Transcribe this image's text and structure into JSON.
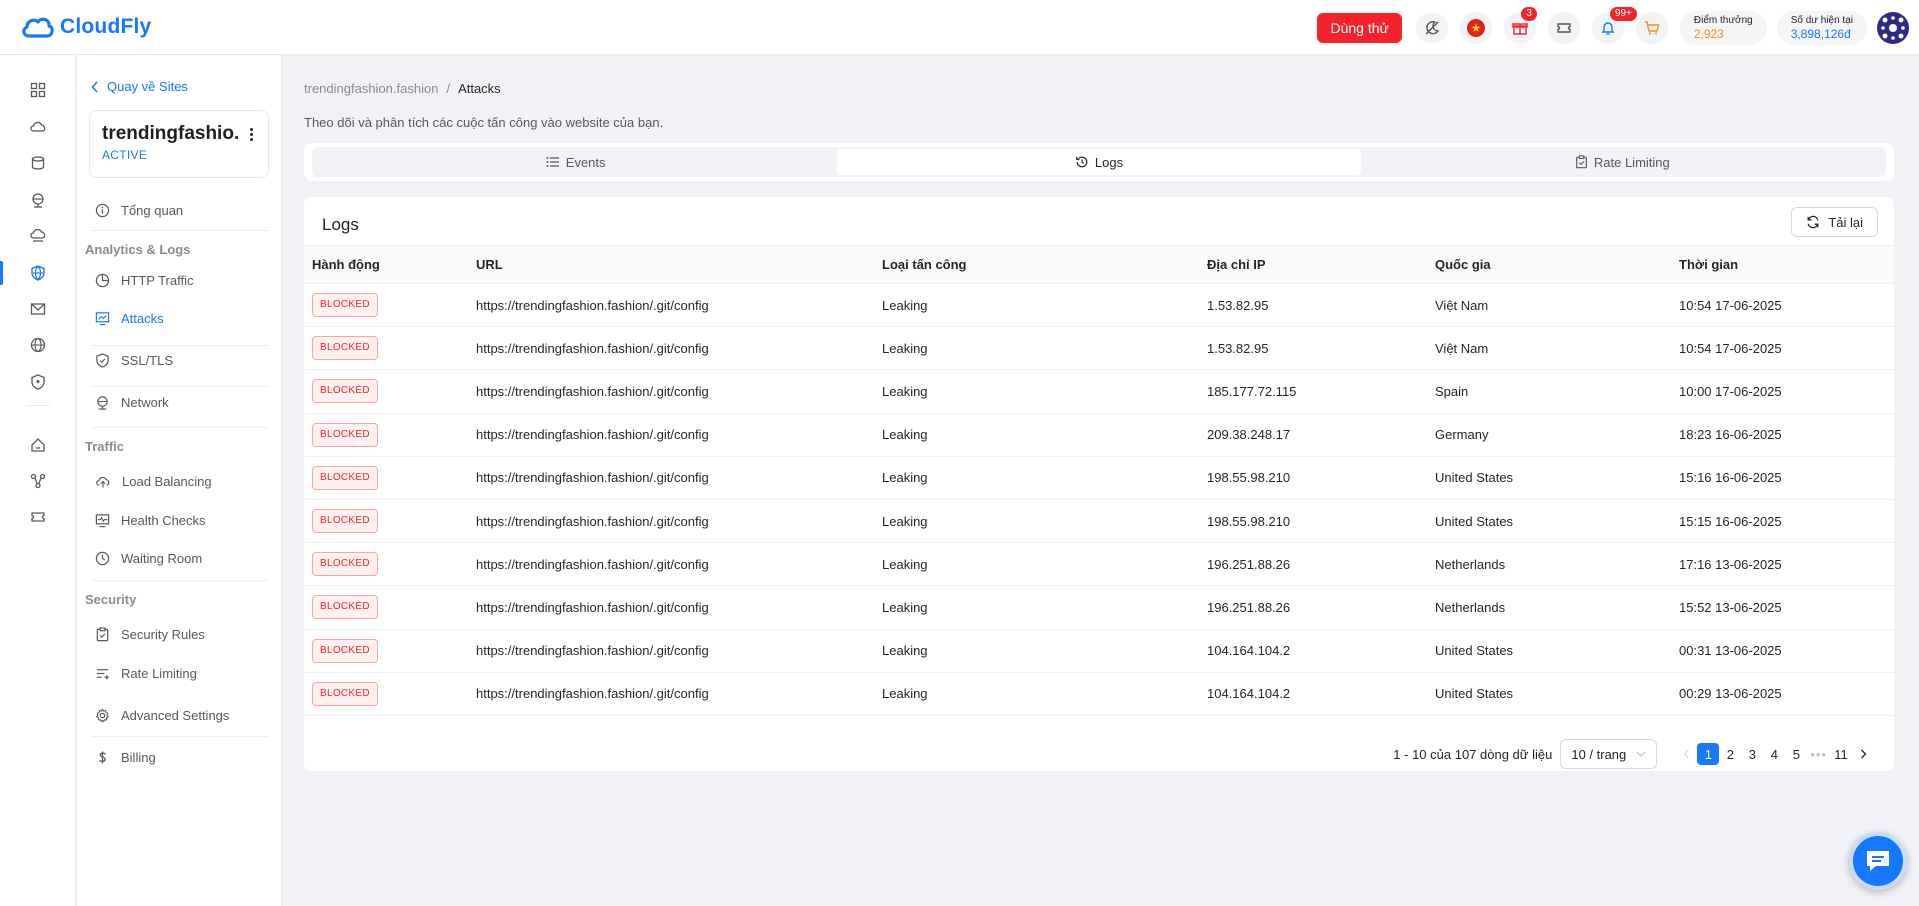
{
  "brand": {
    "name": "CloudFly",
    "color": "#1677ff"
  },
  "header": {
    "trial_label": "Dùng thử",
    "gift_badge": "3",
    "notification_badge": "99+",
    "points_label": "Điểm thưởng",
    "points_value": "2,923",
    "balance_label": "Số dư hiện tại",
    "balance_value": "3,898,126đ"
  },
  "sidebar": {
    "back_label": "Quay về Sites",
    "site_name": "trendingfashion.fashion",
    "site_name_display": "trendingfashio...",
    "site_status": "ACTIVE",
    "overview": "Tổng quan",
    "groups": {
      "analytics": "Analytics & Logs",
      "traffic": "Traffic",
      "security": "Security"
    },
    "items": {
      "http_traffic": "HTTP Traffic",
      "attacks": "Attacks",
      "ssl": "SSL/TLS",
      "network": "Network",
      "load_balancing": "Load Balancing",
      "health_checks": "Health Checks",
      "waiting_room": "Waiting Room",
      "security_rules": "Security Rules",
      "rate_limiting": "Rate Limiting",
      "advanced_settings": "Advanced Settings",
      "billing": "Billing"
    }
  },
  "breadcrumb": {
    "site": "trendingfashion.fashion",
    "separator": "/",
    "current": "Attacks"
  },
  "subtitle": "Theo dõi và phân tích các cuộc tấn công vào website của bạn.",
  "tabs": {
    "events": "Events",
    "logs": "Logs",
    "rate_limiting": "Rate Limiting",
    "active": "Logs"
  },
  "logs": {
    "title": "Logs",
    "reload_label": "Tải lại",
    "columns": {
      "action": "Hành động",
      "url": "URL",
      "attack_type": "Loại tấn công",
      "ip": "Địa chỉ IP",
      "country": "Quốc gia",
      "time": "Thời gian"
    },
    "rows": [
      {
        "action": "BLOCKED",
        "url": "https://trendingfashion.fashion/.git/config",
        "type": "Leaking",
        "ip": "1.53.82.95",
        "country": "Việt Nam",
        "time": "10:54 17-06-2025"
      },
      {
        "action": "BLOCKED",
        "url": "https://trendingfashion.fashion/.git/config",
        "type": "Leaking",
        "ip": "1.53.82.95",
        "country": "Việt Nam",
        "time": "10:54 17-06-2025"
      },
      {
        "action": "BLOCKED",
        "url": "https://trendingfashion.fashion/.git/config",
        "type": "Leaking",
        "ip": "185.177.72.115",
        "country": "Spain",
        "time": "10:00 17-06-2025"
      },
      {
        "action": "BLOCKED",
        "url": "https://trendingfashion.fashion/.git/config",
        "type": "Leaking",
        "ip": "209.38.248.17",
        "country": "Germany",
        "time": "18:23 16-06-2025"
      },
      {
        "action": "BLOCKED",
        "url": "https://trendingfashion.fashion/.git/config",
        "type": "Leaking",
        "ip": "198.55.98.210",
        "country": "United States",
        "time": "15:16 16-06-2025"
      },
      {
        "action": "BLOCKED",
        "url": "https://trendingfashion.fashion/.git/config",
        "type": "Leaking",
        "ip": "198.55.98.210",
        "country": "United States",
        "time": "15:15 16-06-2025"
      },
      {
        "action": "BLOCKED",
        "url": "https://trendingfashion.fashion/.git/config",
        "type": "Leaking",
        "ip": "196.251.88.26",
        "country": "Netherlands",
        "time": "17:16 13-06-2025"
      },
      {
        "action": "BLOCKED",
        "url": "https://trendingfashion.fashion/.git/config",
        "type": "Leaking",
        "ip": "196.251.88.26",
        "country": "Netherlands",
        "time": "15:52 13-06-2025"
      },
      {
        "action": "BLOCKED",
        "url": "https://trendingfashion.fashion/.git/config",
        "type": "Leaking",
        "ip": "104.164.104.2",
        "country": "United States",
        "time": "00:31 13-06-2025"
      },
      {
        "action": "BLOCKED",
        "url": "https://trendingfashion.fashion/.git/config",
        "type": "Leaking",
        "ip": "104.164.104.2",
        "country": "United States",
        "time": "00:29 13-06-2025"
      }
    ]
  },
  "pagination": {
    "summary": "1 - 10 của 107 dòng dữ liệu",
    "page_size": "10 / trang",
    "pages": [
      "1",
      "2",
      "3",
      "4",
      "5"
    ],
    "last_page": "11",
    "current": "1",
    "ellipsis": "•••"
  }
}
